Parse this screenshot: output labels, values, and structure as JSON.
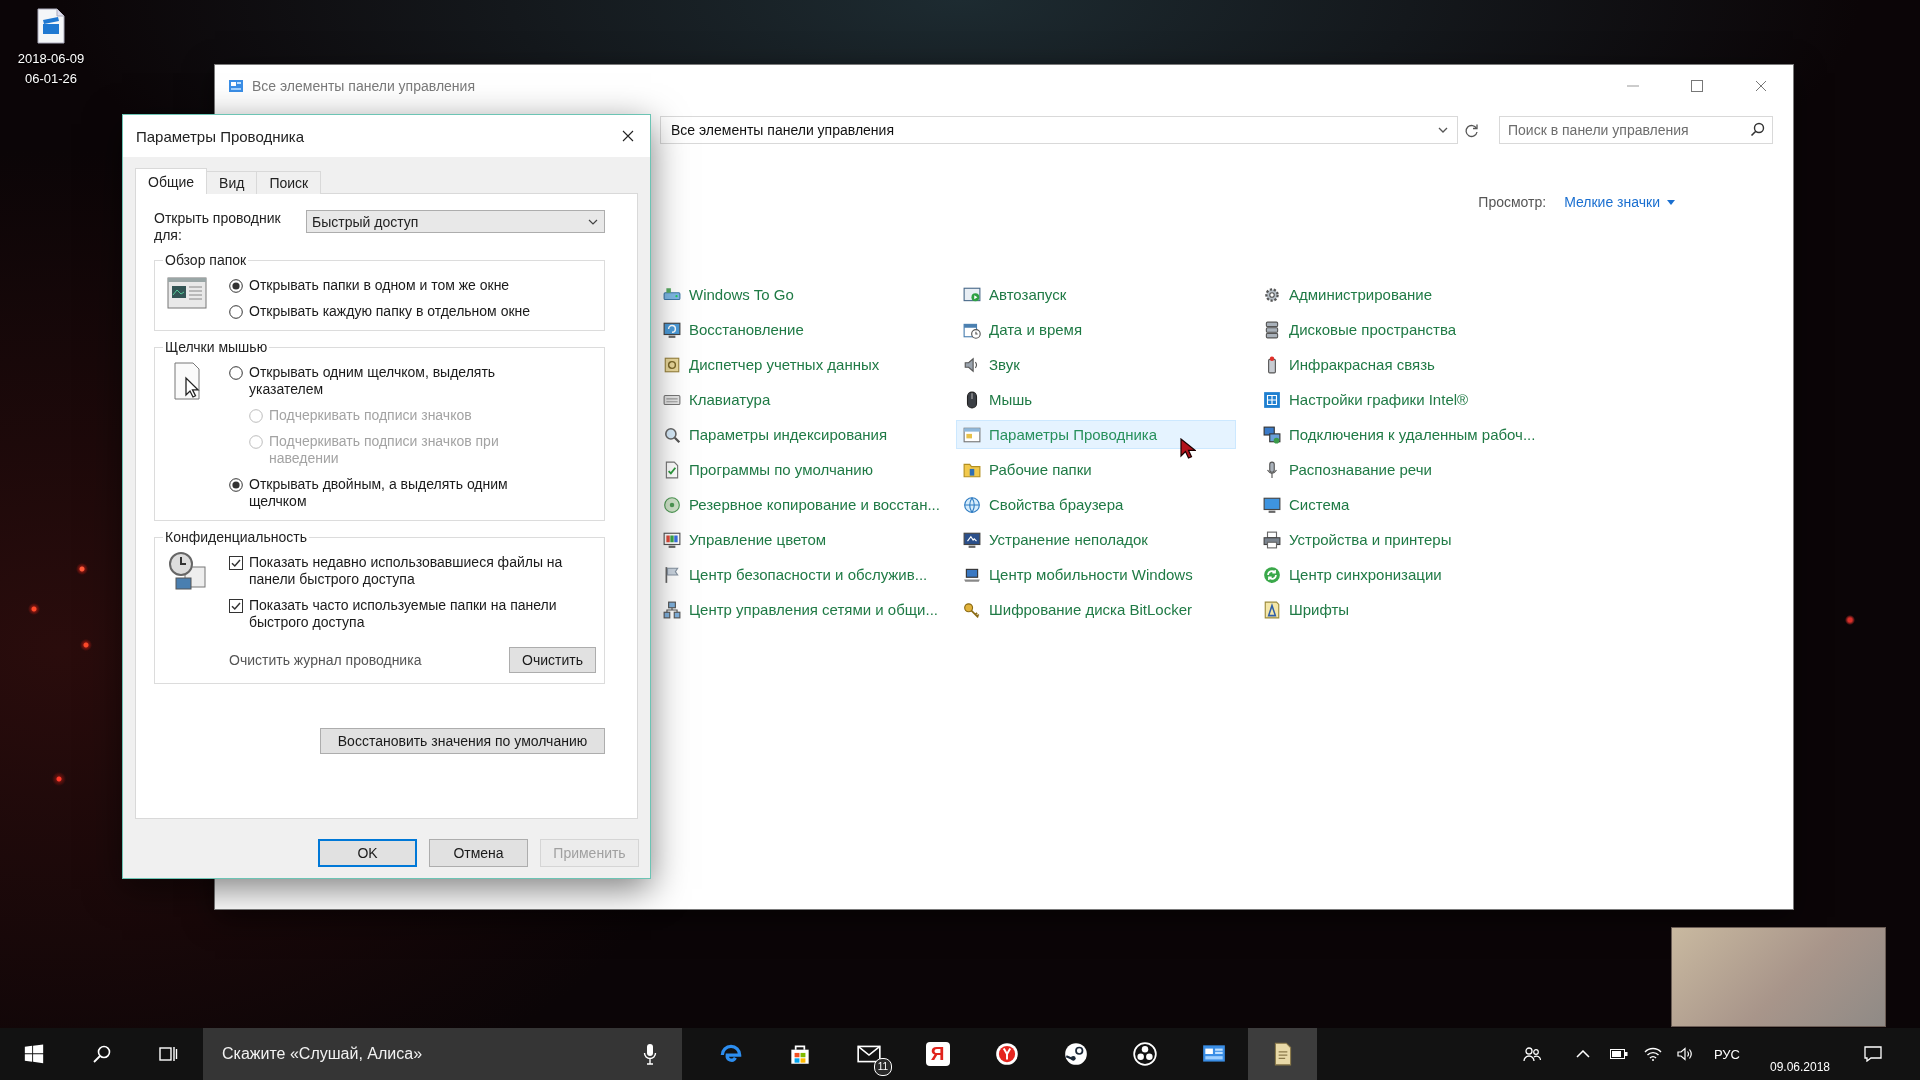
{
  "desktop": {
    "icons": [
      {
        "label": "2018-06-09 06-01-26"
      }
    ]
  },
  "control_panel": {
    "title": "Все элементы панели управления",
    "address": {
      "crumbs": [
        "Все элементы панели управления"
      ]
    },
    "search": {
      "placeholder": "Поиск в панели управления"
    },
    "view_by": {
      "label": "Просмотр:",
      "value": "Мелкие значки"
    },
    "columns": [
      [
        {
          "label": "Windows To Go",
          "hovered": false
        },
        {
          "label": "Восстановление",
          "hovered": false
        },
        {
          "label": "Диспетчер учетных данных",
          "hovered": false
        },
        {
          "label": "Клавиатура",
          "hovered": false
        },
        {
          "label": "Параметры индексирования",
          "hovered": false
        },
        {
          "label": "Программы по умолчанию",
          "hovered": false
        },
        {
          "label": "Резервное копирование и восстан...",
          "hovered": false
        },
        {
          "label": "Управление цветом",
          "hovered": false
        },
        {
          "label": "Центр безопасности и обслужив...",
          "hovered": false
        },
        {
          "label": "Центр управления сетями и общи...",
          "hovered": false
        }
      ],
      [
        {
          "label": "Автозапуск",
          "hovered": false
        },
        {
          "label": "Дата и время",
          "hovered": false
        },
        {
          "label": "Звук",
          "hovered": false
        },
        {
          "label": "Мышь",
          "hovered": false
        },
        {
          "label": "Параметры Проводника",
          "hovered": true
        },
        {
          "label": "Рабочие папки",
          "hovered": false
        },
        {
          "label": "Свойства браузера",
          "hovered": false
        },
        {
          "label": "Устранение неполадок",
          "hovered": false
        },
        {
          "label": "Центр мобильности Windows",
          "hovered": false
        },
        {
          "label": "Шифрование диска BitLocker",
          "hovered": false
        }
      ],
      [
        {
          "label": "Администрирование",
          "hovered": false
        },
        {
          "label": "Дисковые пространства",
          "hovered": false
        },
        {
          "label": "Инфракрасная связь",
          "hovered": false
        },
        {
          "label": "Настройки графики Intel®",
          "hovered": false
        },
        {
          "label": "Подключения к удаленным рабоч...",
          "hovered": false
        },
        {
          "label": "Распознавание речи",
          "hovered": false
        },
        {
          "label": "Система",
          "hovered": false
        },
        {
          "label": "Устройства и принтеры",
          "hovered": false
        },
        {
          "label": "Центр синхронизации",
          "hovered": false
        },
        {
          "label": "Шрифты",
          "hovered": false
        }
      ]
    ]
  },
  "dialog": {
    "title": "Параметры Проводника",
    "tabs": [
      {
        "label": "Общие",
        "selected": true
      },
      {
        "label": "Вид",
        "selected": false
      },
      {
        "label": "Поиск",
        "selected": false
      }
    ],
    "open_in": {
      "label": "Открыть проводник для:",
      "value": "Быстрый доступ"
    },
    "groups": [
      {
        "title": "Обзор папок",
        "options": [
          {
            "kind": "radio",
            "label": "Открывать папки в одном и том же окне",
            "selected": true,
            "disabled": false
          },
          {
            "kind": "radio",
            "label": "Открывать каждую папку в отдельном окне",
            "selected": false,
            "disabled": false
          }
        ]
      },
      {
        "title": "Щелчки мышью",
        "options": [
          {
            "kind": "radio",
            "label": "Открывать одним щелчком, выделять указателем",
            "selected": false,
            "disabled": false,
            "children": [
              {
                "kind": "radio",
                "label": "Подчеркивать подписи значков",
                "selected": false,
                "disabled": true
              },
              {
                "kind": "radio",
                "label": "Подчеркивать подписи значков при наведении",
                "selected": false,
                "disabled": true
              }
            ]
          },
          {
            "kind": "radio",
            "label": "Открывать двойным, а выделять одним щелчком",
            "selected": true,
            "disabled": false
          }
        ]
      },
      {
        "title": "Конфиденциальность",
        "options": [
          {
            "kind": "checkbox",
            "label": "Показать недавно использовавшиеся файлы на панели быстрого доступа",
            "checked": true
          },
          {
            "kind": "checkbox",
            "label": "Показать часто используемые папки на панели быстрого доступа",
            "checked": true
          }
        ],
        "clear": {
          "label": "Очистить журнал проводника",
          "button": "Очистить"
        }
      }
    ],
    "restore_button": "Восстановить значения по умолчанию",
    "buttons": [
      {
        "label": "OK",
        "default": true,
        "disabled": false
      },
      {
        "label": "Отмена",
        "default": false,
        "disabled": false
      },
      {
        "label": "Применить",
        "default": false,
        "disabled": true
      }
    ]
  },
  "taskbar": {
    "search": {
      "placeholder": "Скажите «Слушай, Алиса»"
    },
    "apps": [
      {
        "active": false
      },
      {
        "active": false
      },
      {
        "active": false,
        "badge": "11"
      },
      {
        "active": false,
        "glyph": "Я"
      },
      {
        "active": false
      },
      {
        "active": false
      },
      {
        "active": false
      },
      {
        "active": false
      },
      {
        "active": true
      }
    ],
    "tray": {
      "language": "РУС",
      "date": "09.06.2018"
    }
  }
}
